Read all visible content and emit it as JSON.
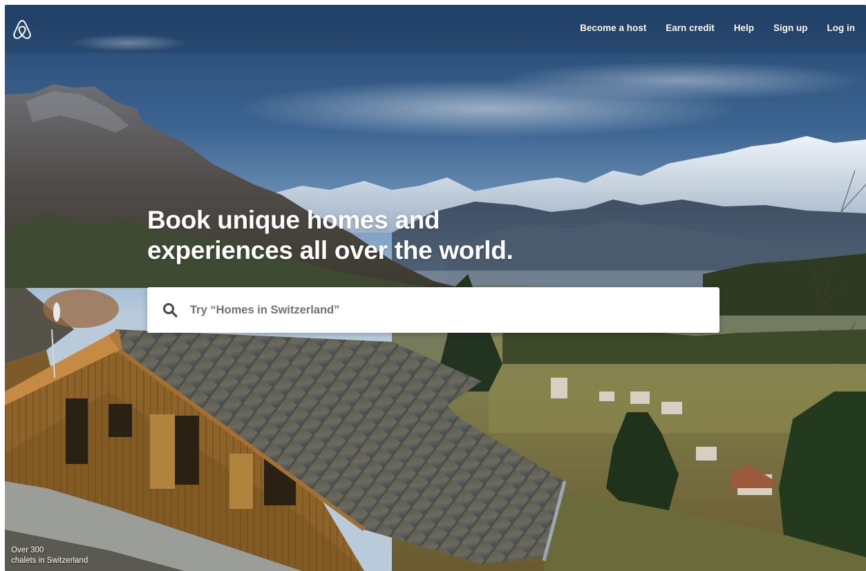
{
  "brand": {
    "logo_icon": "airbnb-belo-icon",
    "logo_color": "#ffffff"
  },
  "nav": {
    "items": [
      {
        "label": "Become a host"
      },
      {
        "label": "Earn credit"
      },
      {
        "label": "Help"
      },
      {
        "label": "Sign up"
      },
      {
        "label": "Log in"
      }
    ]
  },
  "hero": {
    "headline_line1": "Book unique homes and",
    "headline_line2": "experiences all over the world.",
    "search": {
      "icon": "search-icon",
      "placeholder": "Try “Homes in Switzerland”",
      "value": ""
    }
  },
  "photo_caption": {
    "line1": "Over 300",
    "line2": "chalets in Switzerland"
  },
  "colors": {
    "text_on_photo": "#ffffff",
    "search_text": "#484848",
    "placeholder": "#717171"
  }
}
